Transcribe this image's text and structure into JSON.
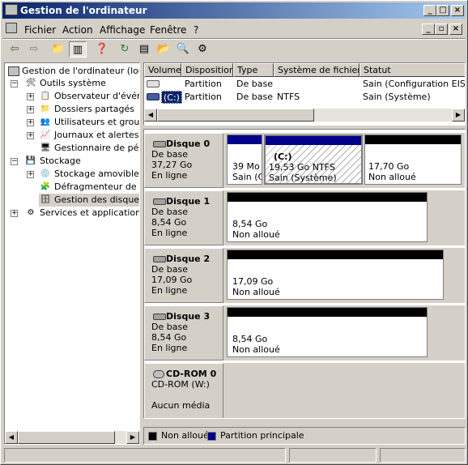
{
  "window": {
    "title": "Gestion de l'ordinateur"
  },
  "menu": {
    "fichier": "Fichier",
    "action": "Action",
    "affichage": "Affichage",
    "fenetre": "Fenêtre",
    "aide": "?"
  },
  "tree": {
    "root": "Gestion de l'ordinateur (local)",
    "outils": "Outils système",
    "observateur": "Observateur d'événe",
    "dossiers": "Dossiers partagés",
    "utilisateurs": "Utilisateurs et groupe",
    "journaux": "Journaux et alertes d",
    "gestionnaire": "Gestionnaire de périp",
    "stockage": "Stockage",
    "amovible": "Stockage amovible",
    "defrag": "Défragmenteur de dis",
    "disques": "Gestion des disques",
    "services": "Services et applications"
  },
  "list": {
    "headers": [
      "Volume",
      "Disposition",
      "Type",
      "Système de fichiers",
      "Statut"
    ],
    "rows": [
      {
        "volume": "",
        "disposition": "Partition",
        "type": "De base",
        "fs": "",
        "statut": "Sain (Configuration EISA)"
      },
      {
        "volume": "(C:)",
        "disposition": "Partition",
        "type": "De base",
        "fs": "NTFS",
        "statut": "Sain (Système)"
      }
    ]
  },
  "disks": {
    "d0": {
      "name": "Disque 0",
      "type": "De base",
      "size": "37,27 Go",
      "state": "En ligne",
      "p1_size": "39 Mo",
      "p1_status": "Sain (C",
      "p2_name": "(C:)",
      "p2_size": "19,53 Go NTFS",
      "p2_status": "Sain (Système)",
      "p3_size": "17,70 Go",
      "p3_status": "Non alloué"
    },
    "d1": {
      "name": "Disque 1",
      "type": "De base",
      "size": "8,54 Go",
      "state": "En ligne",
      "p_size": "8,54 Go",
      "p_status": "Non alloué"
    },
    "d2": {
      "name": "Disque 2",
      "type": "De base",
      "size": "17,09 Go",
      "state": "En ligne",
      "p_size": "17,09 Go",
      "p_status": "Non alloué"
    },
    "d3": {
      "name": "Disque 3",
      "type": "De base",
      "size": "8,54 Go",
      "state": "En ligne",
      "p_size": "8,54 Go",
      "p_status": "Non alloué"
    },
    "cd": {
      "name": "CD-ROM 0",
      "drive": "CD-ROM (W:)",
      "media": "Aucun média"
    }
  },
  "legend": {
    "unallocated": "Non alloué",
    "primary": "Partition principale"
  },
  "colors": {
    "primary": "#00008b",
    "unallocated": "#000000",
    "titlebar": "#0a246a"
  }
}
